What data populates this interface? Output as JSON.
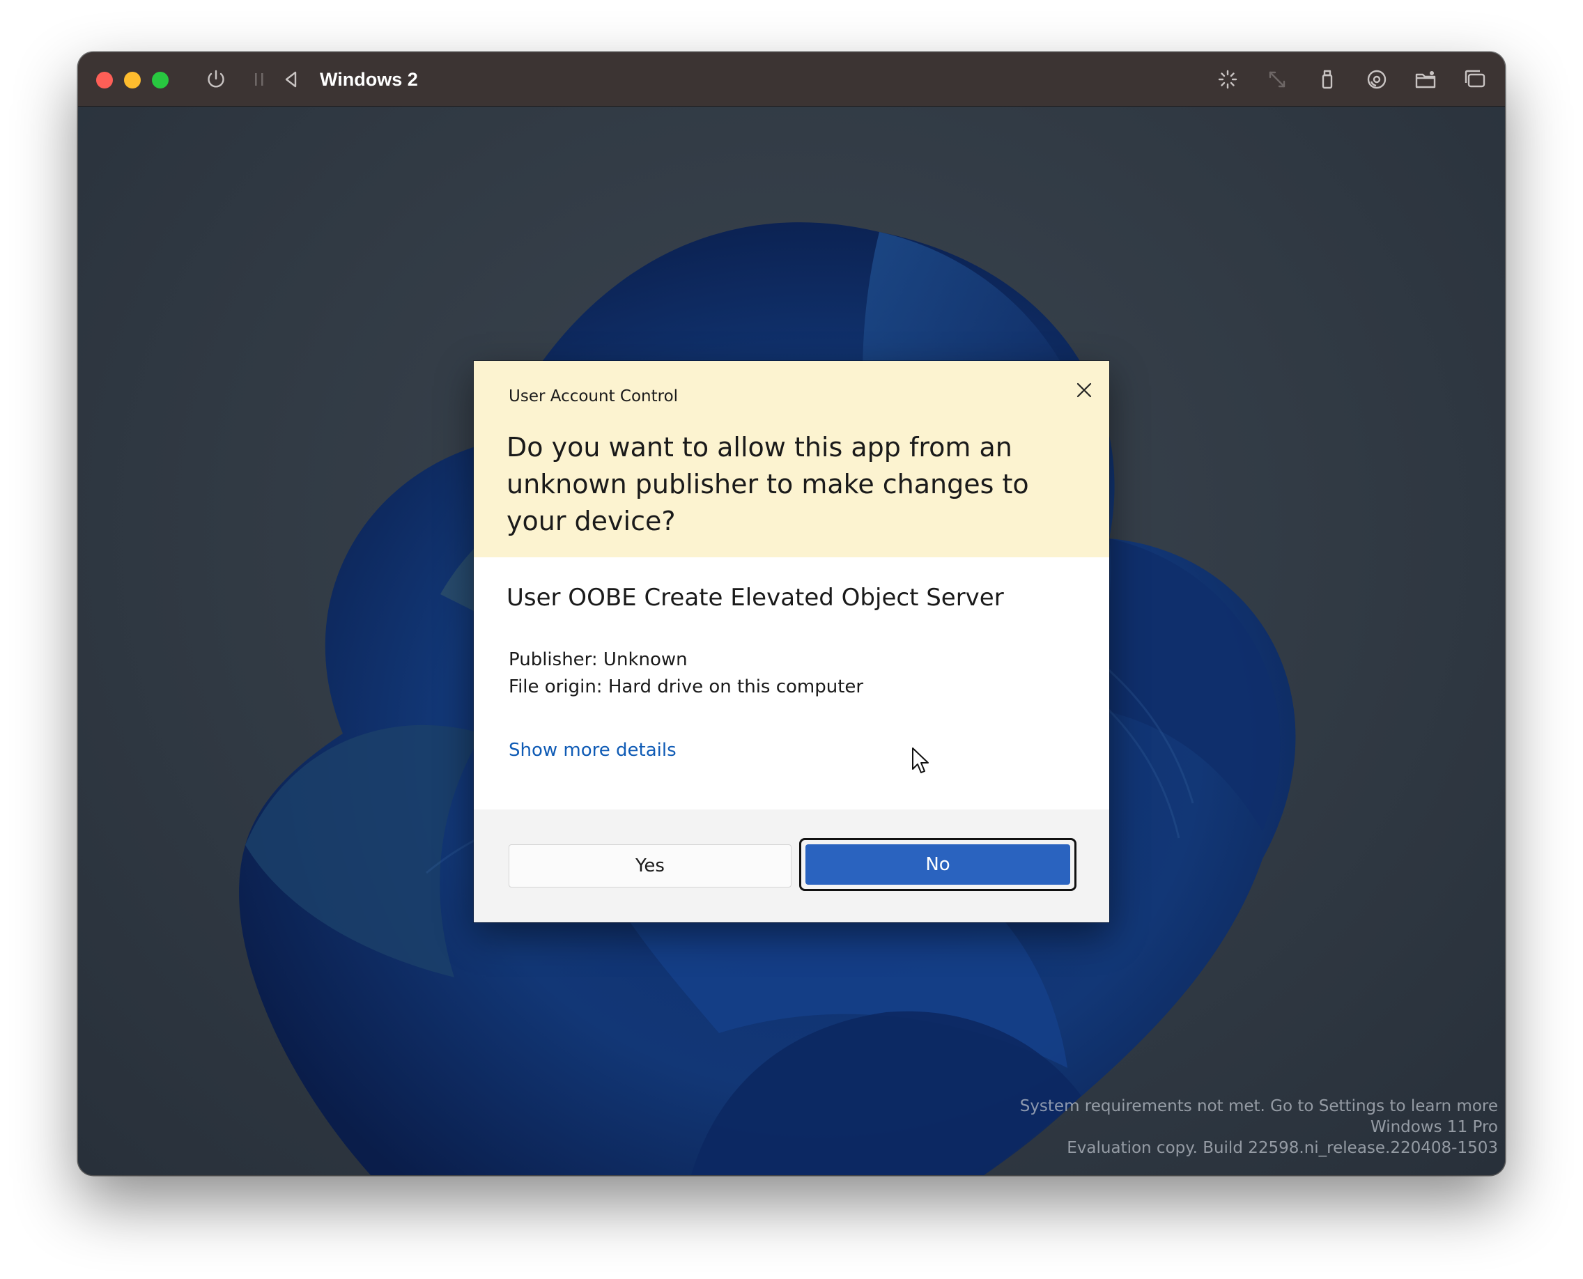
{
  "vm_window": {
    "title": "Windows 2",
    "titlebar_icons": [
      "power-icon",
      "pause-icon",
      "back-icon",
      "brightness-icon",
      "resize-icon",
      "usb-icon",
      "disc-icon",
      "shared-folder-icon",
      "windows-icon"
    ]
  },
  "uac_dialog": {
    "caption": "User Account Control",
    "question": "Do you want to allow this app from an unknown publisher to make changes to your device?",
    "app_name": "User OOBE Create Elevated Object Server",
    "publisher": "Publisher: Unknown",
    "file_origin": "File origin: Hard drive on this computer",
    "show_more": "Show more details",
    "yes_label": "Yes",
    "no_label": "No"
  },
  "watermark": {
    "line1": "System requirements not met. Go to Settings to learn more",
    "line2": "Windows 11 Pro",
    "line3": "Evaluation copy. Build 22598.ni_release.220408-1503"
  },
  "colors": {
    "titlebar": "#3c3433",
    "uac_header": "#fcf3d0",
    "accent_blue": "#2a63bf",
    "link": "#0f5bb5"
  }
}
